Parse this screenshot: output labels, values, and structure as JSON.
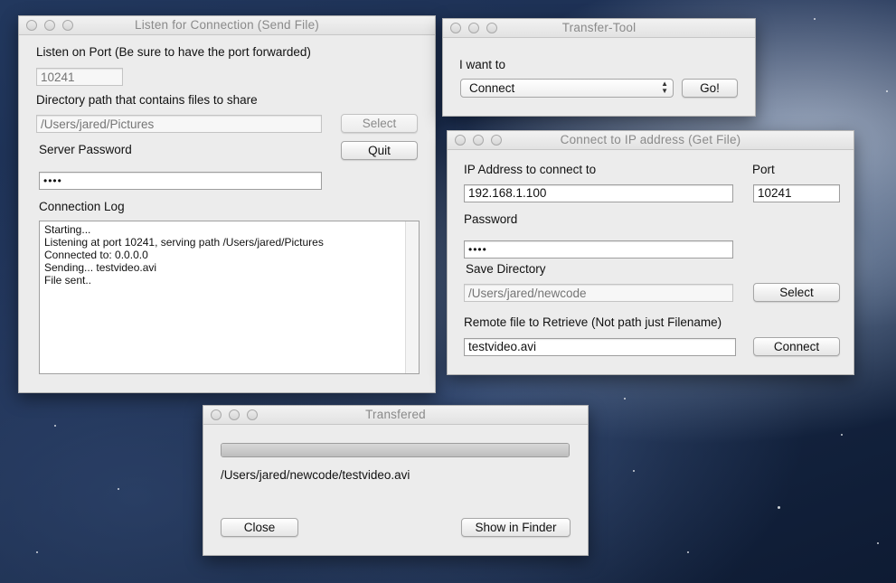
{
  "listen_window": {
    "title": "Listen for Connection (Send File)",
    "port_label": "Listen on Port (Be sure to have the port forwarded)",
    "port_placeholder": "10241",
    "dir_label": "Directory path that contains files to share",
    "dir_placeholder": "/Users/jared/Pictures",
    "select_label": "Select",
    "password_label": "Server Password",
    "quit_label": "Quit",
    "password_value": "••••",
    "log_label": "Connection Log",
    "log_lines": [
      "Starting...",
      "Listening at port 10241, serving path /Users/jared/Pictures",
      "Connected to: 0.0.0.0",
      "Sending... testvideo.avi",
      "File sent.."
    ]
  },
  "transfer_tool": {
    "title": "Transfer-Tool",
    "prompt": "I want to",
    "selected_option": "Connect",
    "go_label": "Go!"
  },
  "connect_window": {
    "title": "Connect to IP address (Get File)",
    "ip_label": "IP Address to connect to",
    "ip_value": "192.168.1.100",
    "port_label": "Port",
    "port_value": "10241",
    "password_label": "Password",
    "password_value": "••••",
    "save_dir_label": "Save Directory",
    "save_dir_placeholder": "/Users/jared/newcode",
    "select_label": "Select",
    "remote_label": "Remote file to Retrieve (Not path just Filename)",
    "remote_value": "testvideo.avi",
    "connect_label": "Connect"
  },
  "transferred_window": {
    "title": "Transfered",
    "progress": 1.0,
    "path": "/Users/jared/newcode/testvideo.avi",
    "close_label": "Close",
    "finder_label": "Show in Finder"
  }
}
